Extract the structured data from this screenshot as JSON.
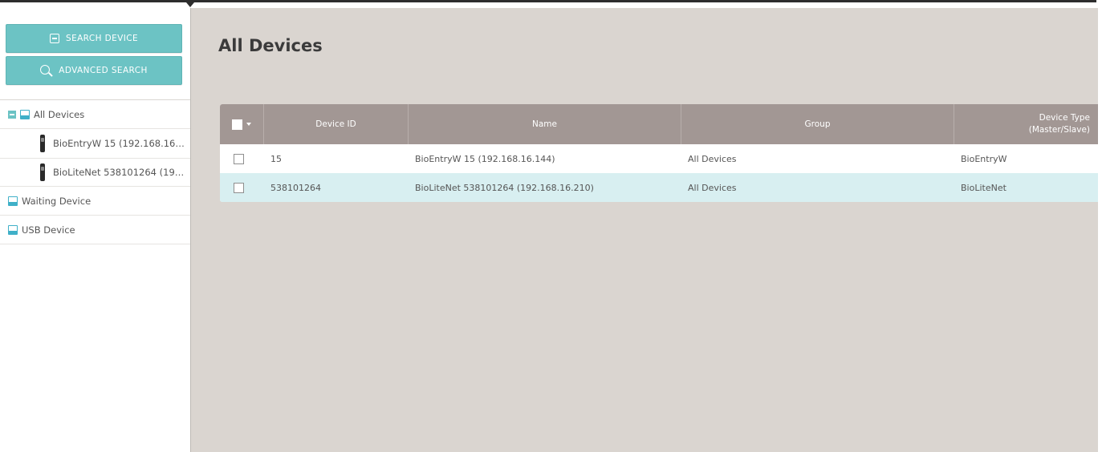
{
  "sidebar": {
    "search_button": "SEARCH DEVICE",
    "advanced_button": "ADVANCED SEARCH",
    "tree": {
      "root": "All Devices",
      "children": [
        "BioEntryW 15 (192.168.16.144)",
        "BioLiteNet 538101264 (192.168.16.210)"
      ],
      "waiting": "Waiting Device",
      "usb": "USB Device"
    }
  },
  "main": {
    "title": "All Devices",
    "table": {
      "headers": {
        "device_id": "Device ID",
        "name": "Name",
        "group": "Group",
        "device_type_1": "Device Type",
        "device_type_2": "(Master/Slave)"
      },
      "rows": [
        {
          "device_id": "15",
          "name": "BioEntryW 15 (192.168.16.144)",
          "group": "All Devices",
          "type": "BioEntryW",
          "selected": false
        },
        {
          "device_id": "538101264",
          "name": "BioLiteNet 538101264 (192.168.16.210)",
          "group": "All Devices",
          "type": "BioLiteNet",
          "selected": true
        }
      ]
    }
  },
  "colors": {
    "accent": "#6cc3c4",
    "table_header": "#a29794",
    "main_bg": "#dad5d0",
    "selected_row": "#d8eff1"
  }
}
